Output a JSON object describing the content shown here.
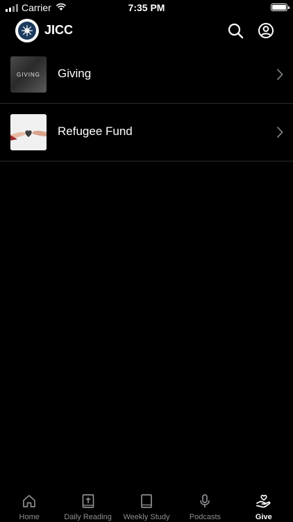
{
  "status_bar": {
    "carrier": "Carrier",
    "time": "7:35 PM",
    "battery_level": 1.0
  },
  "header": {
    "title": "JICC",
    "logo_icon": "jicc-logo-icon",
    "search_icon": "search-icon",
    "account_icon": "account-icon"
  },
  "giving_items": [
    {
      "label": "Giving",
      "thumbnail_text": "GIVING",
      "thumbnail_icon": "giving-thumbnail"
    },
    {
      "label": "Refugee Fund",
      "thumbnail_icon": "refugee-fund-thumbnail"
    }
  ],
  "tabs": [
    {
      "label": "Home",
      "icon": "home-icon",
      "active": false
    },
    {
      "label": "Daily Reading",
      "icon": "bible-icon",
      "active": false
    },
    {
      "label": "Weekly Study",
      "icon": "book-icon",
      "active": false
    },
    {
      "label": "Podcasts",
      "icon": "microphone-icon",
      "active": false
    },
    {
      "label": "Give",
      "icon": "give-hand-heart-icon",
      "active": true
    }
  ],
  "colors": {
    "background": "#000000",
    "text": "#ffffff",
    "inactive_tab": "#8e8e93",
    "separator": "#2c2c2e"
  }
}
